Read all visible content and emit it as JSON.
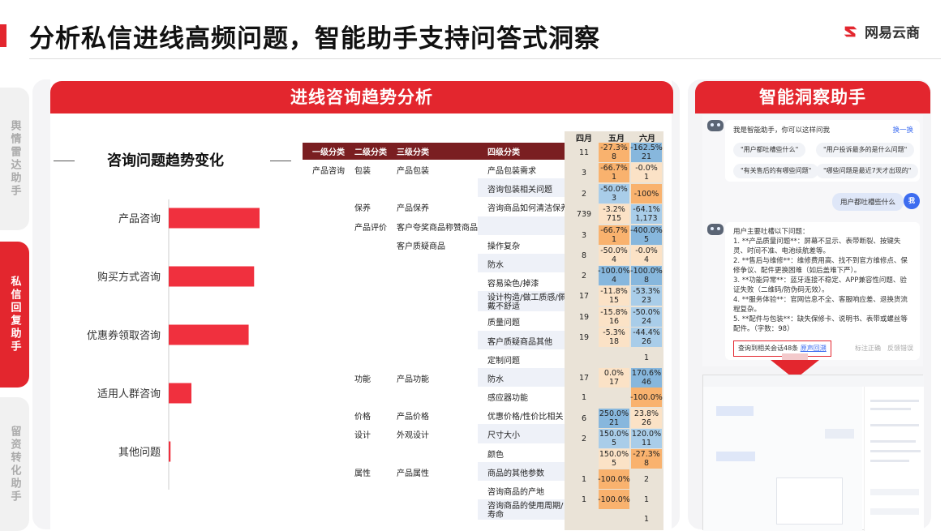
{
  "page_title": "分析私信进线高频问题，智能助手支持问答式洞察",
  "brand": {
    "name": "网易云商",
    "accent": "#e3262e",
    "dark_red": "#7a1e21"
  },
  "side_tabs": [
    {
      "label": "舆情雷达助手",
      "active": false
    },
    {
      "label": "私信回复助手",
      "active": true
    },
    {
      "label": "留资转化助手",
      "active": false
    }
  ],
  "left_section_title": "进线咨询趋势分析",
  "chart": {
    "title": "咨询问题趋势变化"
  },
  "chart_data": {
    "type": "bar",
    "orientation": "horizontal",
    "categories": [
      "产品咨询",
      "购买方式咨询",
      "优惠券领取咨询",
      "适用人群咨询",
      "其他问题"
    ],
    "values": [
      100,
      94,
      88,
      25,
      2
    ],
    "value_scale": "relative",
    "bar_color": "#f0303e",
    "xlim": [
      0,
      100
    ],
    "axis_labels": false
  },
  "table": {
    "headers": [
      "一级分类",
      "二级分类",
      "三级分类",
      "四级分类"
    ],
    "rows": [
      [
        "产品咨询",
        "包装",
        "产品包装",
        "产品包装需求"
      ],
      [
        "",
        "",
        "",
        "咨询包装相关问题"
      ],
      [
        "",
        "保养",
        "产品保养",
        "咨询商品如何清洁保养"
      ],
      [
        "",
        "产品评价",
        "客户夸奖商品称赞商品",
        ""
      ],
      [
        "",
        "",
        "客户质疑商品",
        "操作复杂"
      ],
      [
        "",
        "",
        "",
        "防水"
      ],
      [
        "",
        "",
        "",
        "容易染色/掉漆"
      ],
      [
        "",
        "",
        "",
        "设计构造/做工质感/佩戴不舒适"
      ],
      [
        "",
        "",
        "",
        "质量问题"
      ],
      [
        "",
        "",
        "",
        "客户质疑商品其他"
      ],
      [
        "",
        "",
        "",
        "定制问题"
      ],
      [
        "",
        "功能",
        "产品功能",
        "防水"
      ],
      [
        "",
        "",
        "",
        "感应器功能"
      ],
      [
        "",
        "价格",
        "产品价格",
        "优惠价格/性价比相关"
      ],
      [
        "",
        "设计",
        "外观设计",
        "尺寸大小"
      ],
      [
        "",
        "",
        "",
        "颜色"
      ],
      [
        "",
        "属性",
        "产品属性",
        "商品的其他参数"
      ],
      [
        "",
        "",
        "",
        "咨询商品的产地"
      ],
      [
        "",
        "",
        "",
        "咨询商品的使用周期/寿命"
      ]
    ]
  },
  "heatmap": {
    "months": [
      "四月",
      "五月",
      "六月"
    ],
    "april": [
      "11",
      "3",
      "2",
      "739",
      "3",
      "8",
      "2",
      "17",
      "19",
      "19",
      "17",
      "1",
      "6",
      "2",
      "1",
      "1"
    ],
    "may": [
      "-27.3%\n8",
      "-66.7%\n1",
      "-50.0%\n3",
      "-3.2%\n715",
      "-66.7%\n1",
      "-50.0%\n4",
      "-100.0%\n4",
      "-11.8%\n15",
      "-15.8%\n16",
      "-5.3%\n18",
      "0.0%\n17",
      "250.0%\n21",
      "150.0%\n5",
      "150.0%\n5",
      "-100.0%",
      "-100.0%"
    ],
    "june": [
      "-162.5%\n21",
      "-0.0%\n1",
      "-100%",
      "-64.1%\n1,173",
      "-400.0%\n5",
      "-0.0%\n4",
      "-100.0%\n8",
      "-53.3%\n23",
      "-50.0%\n24",
      "-44.4%\n26",
      "1",
      "170.6%\n46",
      "-100.0%",
      "23.8%\n26",
      "120.0%\n11",
      "-27.3%\n8",
      "2",
      "1",
      "1"
    ]
  },
  "right_section_title": "智能洞察助手",
  "assistant": {
    "greeting": "我是智能助手，你可以这样问我",
    "refresh": "换一换",
    "suggestions": [
      "\"用户都吐槽些什么\"",
      "\"用户投诉最多的是什么问题\"",
      "\"有关售后的有哪些问题\"",
      "\"哪些问题是最近7天才出现的\""
    ],
    "user_question": "用户都吐槽些什么",
    "user_avatar": "我",
    "answer_lines": [
      "用户主要吐槽以下问题：",
      "1. **产品质量问题**：屏幕不显示、表带断裂、按键失灵、时间不准、电池续航差等。",
      "2. **售后与维修**：维修费用高、找不到官方维修点、保修争议、配件更换困难（如后盖难下严）。",
      "3. **功能异常**：蓝牙连接不稳定、APP兼容性问题、验证失败（二维码/防伪码无效）。",
      "4. **服务体验**：官网信息不全、客服响应差、退换货流程复杂。",
      "5. **配件与包装**：缺失保修卡、说明书、表带或螺丝等配件。（字数：98）"
    ],
    "link_text": "查询到相关会话48条",
    "link_action": "原声回溯",
    "feedback_ok": "标注正确",
    "feedback_bad": "反馈错误"
  }
}
